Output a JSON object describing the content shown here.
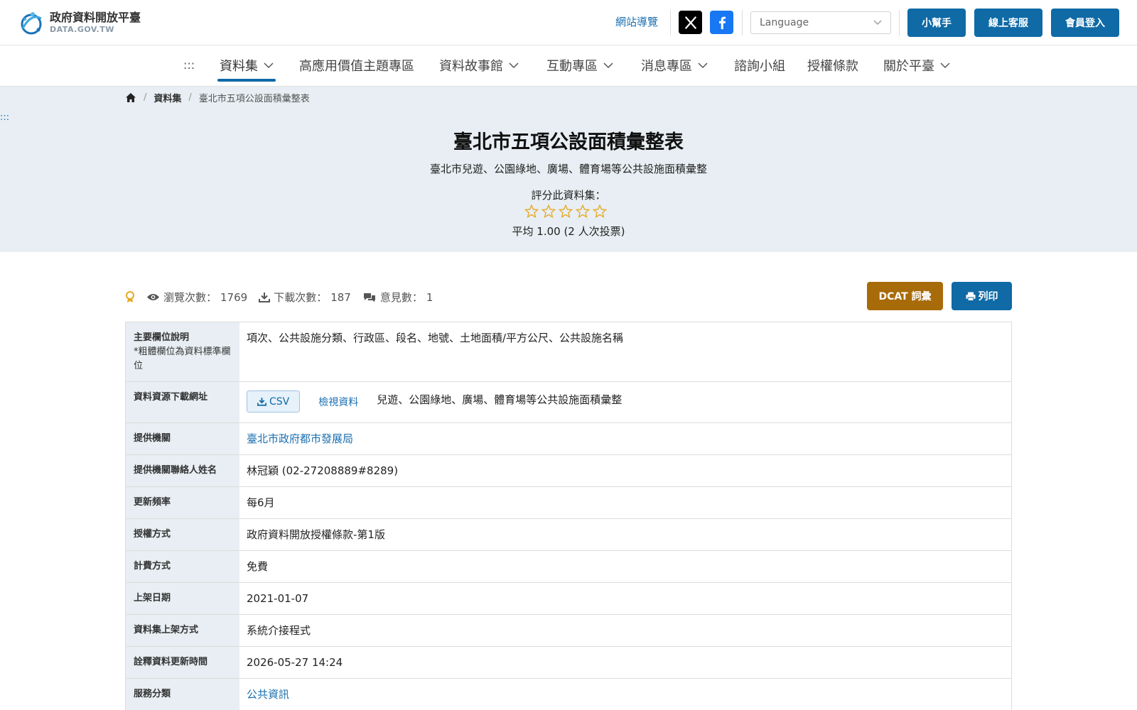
{
  "header": {
    "logo_title": "政府資料開放平臺",
    "logo_sub": "DATA.GOV.TW",
    "sitemap": "網站導覽",
    "language_placeholder": "Language",
    "buttons": [
      "小幫手",
      "線上客服",
      "會員登入"
    ]
  },
  "nav": {
    "accesskey": ":::",
    "items": [
      {
        "label": "資料集",
        "dropdown": true
      },
      {
        "label": "高應用價值主題專區",
        "dropdown": false
      },
      {
        "label": "資料故事館",
        "dropdown": true
      },
      {
        "label": "互動專區",
        "dropdown": true
      },
      {
        "label": "消息專區",
        "dropdown": true
      },
      {
        "label": "諮詢小組",
        "dropdown": false
      },
      {
        "label": "授權條款",
        "dropdown": false
      },
      {
        "label": "關於平臺",
        "dropdown": true
      }
    ]
  },
  "breadcrumb": {
    "section": "資料集",
    "current": "臺北市五項公設面積彙整表"
  },
  "skip_link": ":::",
  "dataset": {
    "title": "臺北市五項公設面積彙整表",
    "description": "臺北市兒遊、公園綠地、廣場、體育場等公共設施面積彙整",
    "rate_label": "評分此資料集：",
    "avg_text": "平均 1.00 (2 人次投票)"
  },
  "stats": {
    "views_label": "瀏覽次數：",
    "views": "1769",
    "downloads_label": "下載次數：",
    "downloads": "187",
    "comments_label": "意見數：",
    "comments": "1"
  },
  "actions": {
    "dcat": "DCAT 詞彙",
    "print": "列印"
  },
  "info": {
    "fields_label": "主要欄位說明",
    "fields_note": "*粗體欄位為資料標準欄位",
    "fields_value": "項次、公共設施分類、行政區、段名、地號、土地面積/平方公尺、公共設施名稱",
    "resource_label": "資料資源下載網址",
    "csv": "CSV",
    "view_data": "檢視資料",
    "resource_desc": "兒遊、公園綠地、廣場、體育場等公共設施面積彙整",
    "agency_label": "提供機關",
    "agency": "臺北市政府都市發展局",
    "contact_label": "提供機關聯絡人姓名",
    "contact": "林冠穎 (02-27208889#8289)",
    "freq_label": "更新頻率",
    "freq": "每6月",
    "license_label": "授權方式",
    "license": "政府資料開放授權條款-第1版",
    "fee_label": "計費方式",
    "fee": "免費",
    "date_label": "上架日期",
    "date": "2021-01-07",
    "method_label": "資料集上架方式",
    "method": "系統介接程式",
    "meta_label": "詮釋資料更新時間",
    "meta": "2026-05-27 14:24",
    "category_label": "服務分類",
    "category": "公共資訊"
  },
  "colors": {
    "primary": "#0f6aa6",
    "dcat": "#a86b0a",
    "hero_bg": "#e8eef3",
    "star": "#e5a823"
  }
}
